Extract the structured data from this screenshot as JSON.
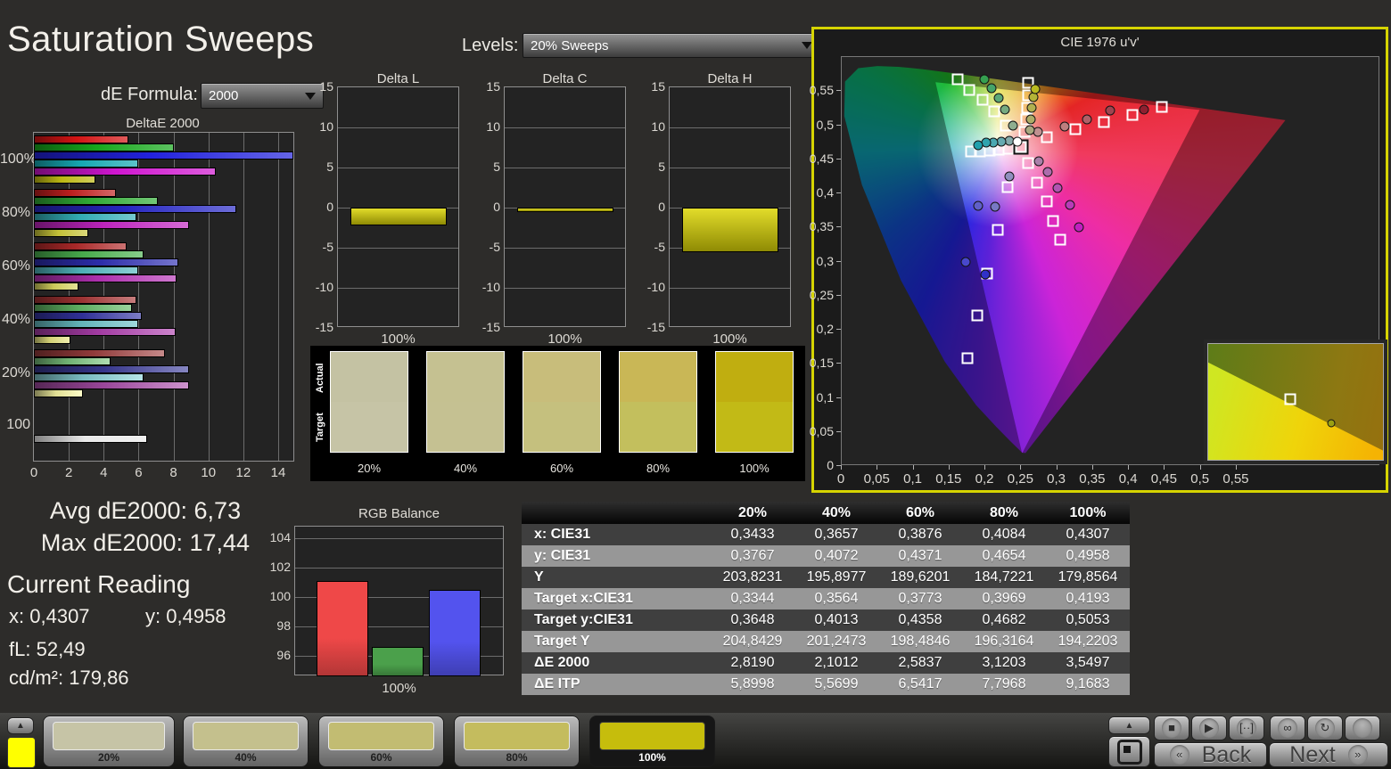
{
  "title": "Saturation Sweeps",
  "de_formula": {
    "label": "dE Formula:",
    "value": "2000"
  },
  "levels": {
    "label": "Levels:",
    "value": "20% Sweeps"
  },
  "summary": {
    "avg": "Avg dE2000: 6,73",
    "max": "Max dE2000: 17,44"
  },
  "current_reading": {
    "title": "Current Reading",
    "x_label": "x:",
    "x_value": "0,4307",
    "y_label": "y:",
    "y_value": "0,4958",
    "fl_label": "fL:",
    "fl_value": "52,49",
    "cd_label": "cd/m²:",
    "cd_value": "179,86"
  },
  "chart_data": [
    {
      "id": "deltae2000",
      "type": "bar",
      "orientation": "horizontal",
      "title": "DeltaE 2000",
      "xlim": [
        0,
        14
      ],
      "xticks": [
        0,
        2,
        4,
        6,
        8,
        10,
        12,
        14
      ],
      "xtick_labels": [
        "0",
        "2",
        "4",
        "6",
        "8",
        "10",
        "12",
        "14"
      ],
      "series_colors": {
        "red": "#d21414",
        "green": "#16a81c",
        "blue": "#2222dc",
        "cyan": "#16a8b2",
        "magenta": "#cf16cf",
        "yellow": "#bcb813",
        "white": "#e9e9e9"
      },
      "groups": [
        {
          "label": "100%",
          "bars": [
            {
              "color": "red",
              "value": 5.4
            },
            {
              "color": "green",
              "value": 8.0
            },
            {
              "color": "blue",
              "value": 17.44
            },
            {
              "color": "cyan",
              "value": 6.0
            },
            {
              "color": "magenta",
              "value": 10.4
            },
            {
              "color": "yellow",
              "value": 3.55
            }
          ]
        },
        {
          "label": "80%",
          "bars": [
            {
              "color": "red",
              "value": 4.7
            },
            {
              "color": "green",
              "value": 7.1
            },
            {
              "color": "blue",
              "value": 11.6
            },
            {
              "color": "cyan",
              "value": 5.9
            },
            {
              "color": "magenta",
              "value": 8.9
            },
            {
              "color": "yellow",
              "value": 3.12
            }
          ]
        },
        {
          "label": "60%",
          "bars": [
            {
              "color": "red",
              "value": 5.3
            },
            {
              "color": "green",
              "value": 6.3
            },
            {
              "color": "blue",
              "value": 8.3
            },
            {
              "color": "cyan",
              "value": 6.0
            },
            {
              "color": "magenta",
              "value": 8.2
            },
            {
              "color": "yellow",
              "value": 2.58
            }
          ]
        },
        {
          "label": "40%",
          "bars": [
            {
              "color": "red",
              "value": 5.9
            },
            {
              "color": "green",
              "value": 5.6
            },
            {
              "color": "blue",
              "value": 6.2
            },
            {
              "color": "cyan",
              "value": 6.0
            },
            {
              "color": "magenta",
              "value": 8.1
            },
            {
              "color": "yellow",
              "value": 2.1
            }
          ]
        },
        {
          "label": "20%",
          "bars": [
            {
              "color": "red",
              "value": 7.5
            },
            {
              "color": "green",
              "value": 4.4
            },
            {
              "color": "blue",
              "value": 8.9
            },
            {
              "color": "cyan",
              "value": 6.3
            },
            {
              "color": "magenta",
              "value": 8.9
            },
            {
              "color": "yellow",
              "value": 2.82
            }
          ]
        },
        {
          "label": "100",
          "bars": [
            {
              "color": "white",
              "value": 6.5
            }
          ]
        }
      ]
    },
    {
      "id": "delta_l",
      "type": "bar",
      "title": "Delta L",
      "ylim": [
        -15,
        15
      ],
      "yticks": [
        15,
        10,
        5,
        0,
        -5,
        -10,
        -15
      ],
      "category": "100%",
      "value": -2.2
    },
    {
      "id": "delta_c",
      "type": "bar",
      "title": "Delta C",
      "ylim": [
        -15,
        15
      ],
      "yticks": [
        15,
        10,
        5,
        0,
        -5,
        -10,
        -15
      ],
      "category": "100%",
      "value": -0.6
    },
    {
      "id": "delta_h",
      "type": "bar",
      "title": "Delta H",
      "ylim": [
        -15,
        15
      ],
      "yticks": [
        15,
        10,
        5,
        0,
        -5,
        -10,
        -15
      ],
      "category": "100%",
      "value": -5.5
    },
    {
      "id": "rgb_balance",
      "type": "bar",
      "title": "RGB Balance",
      "ylim": [
        94.6,
        104.8
      ],
      "yticks": [
        96,
        98,
        100,
        102,
        104
      ],
      "category": "100%",
      "series": [
        {
          "name": "Red",
          "value": 101.1,
          "color": "#ef4848"
        },
        {
          "name": "Green",
          "value": 96.6,
          "color": "#4ba04b"
        },
        {
          "name": "Blue",
          "value": 100.5,
          "color": "#5353ee"
        }
      ]
    },
    {
      "id": "cie",
      "type": "scatter",
      "title": "CIE 1976 u'v'",
      "xlim": [
        0,
        0.75
      ],
      "ylim": [
        0,
        0.6
      ],
      "xticks": [
        0,
        0.05,
        0.1,
        0.15,
        0.2,
        0.25,
        0.3,
        0.35,
        0.4,
        0.45,
        0.5,
        0.55
      ],
      "xtick_labels": [
        "0",
        "0,05",
        "0,1",
        "0,15",
        "0,2",
        "0,25",
        "0,3",
        "0,35",
        "0,4",
        "0,45",
        "0,5",
        "0,55"
      ],
      "yticks": [
        0,
        0.05,
        0.1,
        0.15,
        0.2,
        0.25,
        0.3,
        0.35,
        0.4,
        0.45,
        0.5,
        0.55
      ],
      "ytick_labels": [
        "0",
        "0,05",
        "0,1",
        "0,15",
        "0,2",
        "0,25",
        "0,3",
        "0,35",
        "0,4",
        "0,45",
        "0,5",
        "0,55"
      ],
      "marker_legend": {
        "square": "target",
        "circle": "measured"
      },
      "locus": [
        [
          0.2568,
          0.0165
        ],
        [
          0.2522,
          0.0169
        ],
        [
          0.2347,
          0.035
        ],
        [
          0.2161,
          0.0549
        ],
        [
          0.1877,
          0.0871
        ],
        [
          0.1441,
          0.151
        ],
        [
          0.0828,
          0.2708
        ],
        [
          0.0282,
          0.4117
        ],
        [
          0.0035,
          0.5131
        ],
        [
          0.0046,
          0.5638
        ],
        [
          0.0231,
          0.5836
        ],
        [
          0.05,
          0.5867
        ],
        [
          0.0792,
          0.5856
        ],
        [
          0.1127,
          0.5821
        ],
        [
          0.1531,
          0.5766
        ],
        [
          0.2026,
          0.5693
        ],
        [
          0.2623,
          0.5604
        ],
        [
          0.3315,
          0.5501
        ],
        [
          0.4035,
          0.5393
        ],
        [
          0.4692,
          0.5296
        ],
        [
          0.5203,
          0.5219
        ],
        [
          0.5565,
          0.5165
        ],
        [
          0.6005,
          0.5099
        ],
        [
          0.6199,
          0.507
        ]
      ],
      "triangle": [
        [
          0.131,
          0.563
        ],
        [
          0.5,
          0.522
        ],
        [
          0.252,
          0.016
        ]
      ],
      "series": [
        {
          "name": "red",
          "targets": [
            [
              0.285,
              0.483
            ],
            [
              0.325,
              0.494
            ],
            [
              0.365,
              0.504
            ],
            [
              0.405,
              0.515
            ],
            [
              0.446,
              0.527
            ]
          ],
          "measured": [
            [
              0.273,
              0.49
            ],
            [
              0.31,
              0.498
            ],
            [
              0.341,
              0.509
            ],
            [
              0.374,
              0.521
            ],
            [
              0.421,
              0.523
            ]
          ],
          "measured_colors": [
            "#c09090",
            "#bd7e7e",
            "#b06068",
            "#a04450",
            "#8e2030"
          ]
        },
        {
          "name": "green",
          "targets": [
            [
              0.228,
              0.499
            ],
            [
              0.212,
              0.52
            ],
            [
              0.196,
              0.537
            ],
            [
              0.178,
              0.551
            ],
            [
              0.161,
              0.567
            ]
          ],
          "measured": [
            [
              0.239,
              0.5
            ],
            [
              0.227,
              0.523
            ],
            [
              0.218,
              0.54
            ],
            [
              0.209,
              0.554
            ],
            [
              0.199,
              0.567
            ]
          ],
          "measured_colors": [
            "#8fae8f",
            "#76ab80",
            "#5ca878",
            "#45a468",
            "#35a050"
          ]
        },
        {
          "name": "blue",
          "targets": [
            [
              0.231,
              0.409
            ],
            [
              0.217,
              0.346
            ],
            [
              0.203,
              0.283
            ],
            [
              0.189,
              0.221
            ],
            [
              0.175,
              0.158
            ]
          ],
          "measured": [
            [
              0.233,
              0.425
            ],
            [
              0.213,
              0.381
            ],
            [
              0.19,
              0.382
            ],
            [
              0.172,
              0.299
            ],
            [
              0.2,
              0.281
            ]
          ],
          "measured_colors": [
            "#9090c0",
            "#7878c4",
            "#6060c8",
            "#4848cc",
            "#3030c8"
          ]
        },
        {
          "name": "cyan",
          "targets": [
            [
              0.232,
              0.465
            ],
            [
              0.219,
              0.464
            ],
            [
              0.206,
              0.463
            ],
            [
              0.193,
              0.462
            ],
            [
              0.18,
              0.461
            ]
          ],
          "measured": [
            [
              0.233,
              0.477
            ],
            [
              0.222,
              0.476
            ],
            [
              0.211,
              0.475
            ],
            [
              0.201,
              0.474
            ],
            [
              0.19,
              0.471
            ]
          ],
          "measured_colors": [
            "#84aaaa",
            "#66aab0",
            "#4aa8b2",
            "#30a4ae",
            "#20a0ac"
          ]
        },
        {
          "name": "magenta",
          "targets": [
            [
              0.259,
              0.444
            ],
            [
              0.272,
              0.416
            ],
            [
              0.285,
              0.388
            ],
            [
              0.294,
              0.36
            ],
            [
              0.304,
              0.332
            ]
          ],
          "measured": [
            [
              0.274,
              0.447
            ],
            [
              0.287,
              0.432
            ],
            [
              0.301,
              0.408
            ],
            [
              0.318,
              0.383
            ],
            [
              0.33,
              0.35
            ]
          ],
          "measured_colors": [
            "#aa80aa",
            "#ad6cad",
            "#b254b2",
            "#b83cb8",
            "#c020c0"
          ]
        },
        {
          "name": "yellow",
          "targets": [
            [
              0.255,
              0.49
            ],
            [
              0.257,
              0.508
            ],
            [
              0.258,
              0.526
            ],
            [
              0.259,
              0.544
            ],
            [
              0.26,
              0.562
            ]
          ],
          "measured": [
            [
              0.262,
              0.493
            ],
            [
              0.263,
              0.509
            ],
            [
              0.265,
              0.526
            ],
            [
              0.267,
              0.541
            ],
            [
              0.269,
              0.553
            ]
          ],
          "measured_colors": [
            "#a8a880",
            "#acac68",
            "#b0b050",
            "#b4b438",
            "#baba20"
          ]
        },
        {
          "name": "white",
          "current": true,
          "targets": [
            [
              0.249,
              0.468
            ]
          ],
          "measured": [
            [
              0.245,
              0.476
            ]
          ],
          "measured_colors": [
            "#ffffff"
          ]
        }
      ],
      "inset": {
        "target": {
          "x_pct": 47,
          "y_pct": 48
        },
        "measured": {
          "x_pct": 70,
          "y_pct": 68
        }
      }
    }
  ],
  "swatches": {
    "row_labels": [
      "Actual",
      "Target"
    ],
    "columns": [
      {
        "label": "20%",
        "actual": "#c4c2a3",
        "target": "#c6c4a6"
      },
      {
        "label": "40%",
        "actual": "#c5c191",
        "target": "#c5c192"
      },
      {
        "label": "60%",
        "actual": "#c8bd7b",
        "target": "#c5c07e"
      },
      {
        "label": "80%",
        "actual": "#c9b756",
        "target": "#c3bf5d"
      },
      {
        "label": "100%",
        "actual": "#c0ae10",
        "target": "#c2ba16"
      }
    ]
  },
  "table": {
    "columns": [
      "",
      "20%",
      "40%",
      "60%",
      "80%",
      "100%"
    ],
    "rows": [
      {
        "label": "x: CIE31",
        "values": [
          "0,3433",
          "0,3657",
          "0,3876",
          "0,4084",
          "0,4307"
        ]
      },
      {
        "label": "y: CIE31",
        "values": [
          "0,3767",
          "0,4072",
          "0,4371",
          "0,4654",
          "0,4958"
        ]
      },
      {
        "label": "Y",
        "values": [
          "203,8231",
          "195,8977",
          "189,6201",
          "184,7221",
          "179,8564"
        ]
      },
      {
        "label": "Target x:CIE31",
        "values": [
          "0,3344",
          "0,3564",
          "0,3773",
          "0,3969",
          "0,4193"
        ]
      },
      {
        "label": "Target y:CIE31",
        "values": [
          "0,3648",
          "0,4013",
          "0,4358",
          "0,4682",
          "0,5053"
        ]
      },
      {
        "label": "Target Y",
        "values": [
          "204,8429",
          "201,2473",
          "198,4846",
          "196,3164",
          "194,2203"
        ]
      },
      {
        "label": "ΔE 2000",
        "values": [
          "2,8190",
          "2,1012",
          "2,5837",
          "3,1203",
          "3,5497"
        ]
      },
      {
        "label": "ΔE ITP",
        "values": [
          "5,8998",
          "5,5699",
          "6,5417",
          "7,7968",
          "9,1683"
        ]
      }
    ]
  },
  "bottom_bar": {
    "current_swatch_color": "#ffff00",
    "patches": [
      {
        "label": "20%",
        "color": "#c6c4a6",
        "selected": false
      },
      {
        "label": "40%",
        "color": "#c4c08d",
        "selected": false
      },
      {
        "label": "60%",
        "color": "#c2bc72",
        "selected": false
      },
      {
        "label": "80%",
        "color": "#c4bc5e",
        "selected": false
      },
      {
        "label": "100%",
        "color": "#c6bd0c",
        "selected": true
      }
    ]
  },
  "transport": {
    "buttons": [
      {
        "icon": "stop"
      },
      {
        "icon": "play"
      },
      {
        "icon": "pattern-window"
      },
      {
        "icon": "continuous"
      },
      {
        "icon": "loop"
      },
      {
        "icon": "blank"
      }
    ],
    "back_label": "Back",
    "next_label": "Next",
    "prev_symbol": "«",
    "next_symbol": "»"
  }
}
